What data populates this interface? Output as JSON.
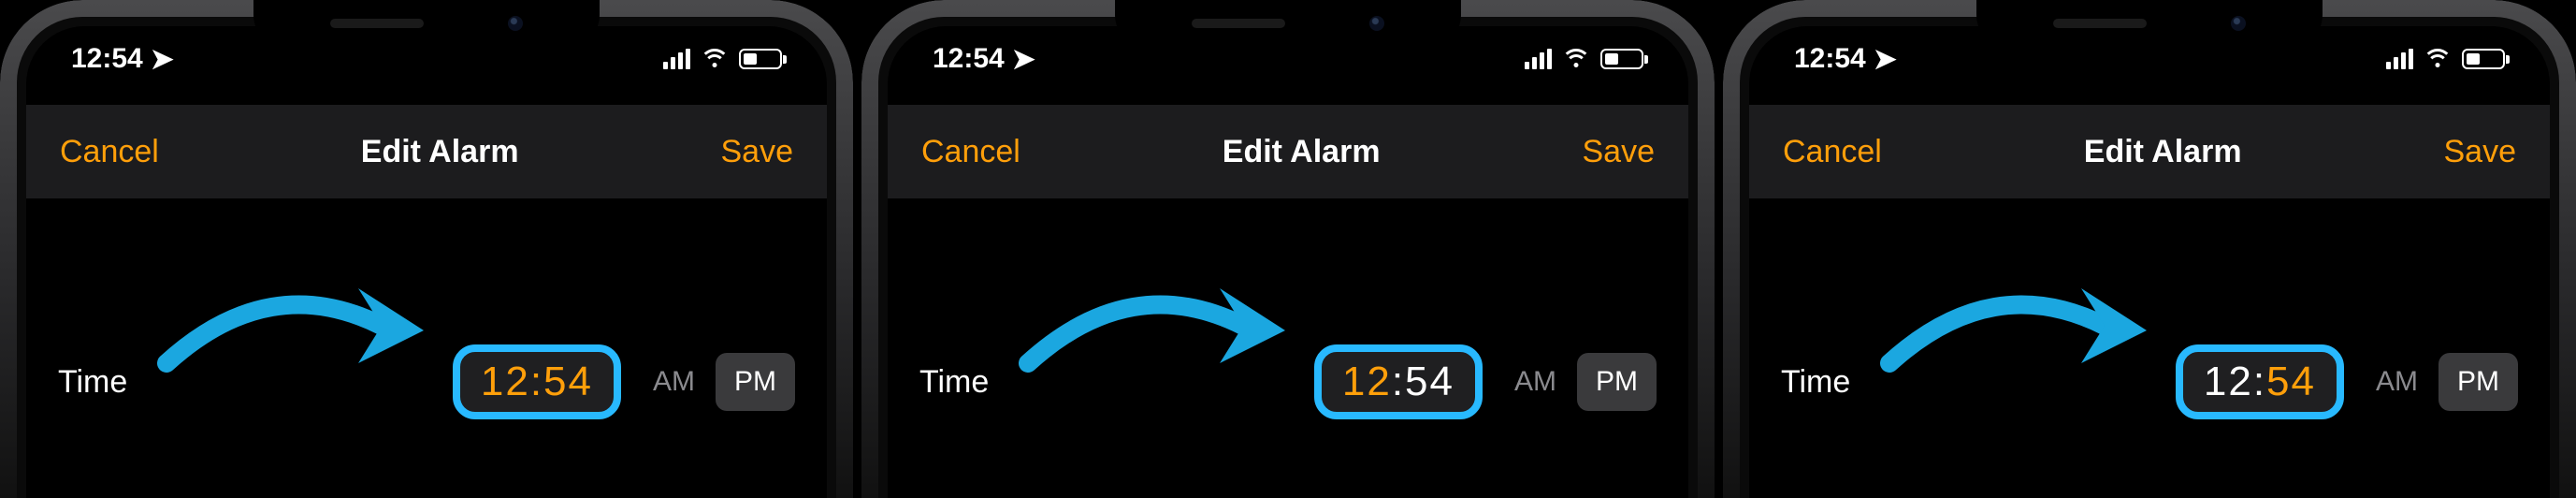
{
  "status": {
    "time": "12:54",
    "location_glyph": "➤"
  },
  "nav": {
    "cancel": "Cancel",
    "title": "Edit Alarm",
    "save": "Save"
  },
  "row": {
    "label": "Time",
    "am": "AM",
    "pm": "PM"
  },
  "colors": {
    "accent": "#ff9f0a",
    "highlight": "#28b9ff",
    "arrow": "#1ba7e0"
  },
  "screens": [
    {
      "time": {
        "hour": "12",
        "minute": "54"
      },
      "highlight": "both",
      "am_selected": false,
      "pm_selected": true
    },
    {
      "time": {
        "hour": "12",
        "minute": "54"
      },
      "highlight": "hour",
      "am_selected": false,
      "pm_selected": true
    },
    {
      "time": {
        "hour": "12",
        "minute": "54"
      },
      "highlight": "minute",
      "am_selected": false,
      "pm_selected": true
    }
  ]
}
